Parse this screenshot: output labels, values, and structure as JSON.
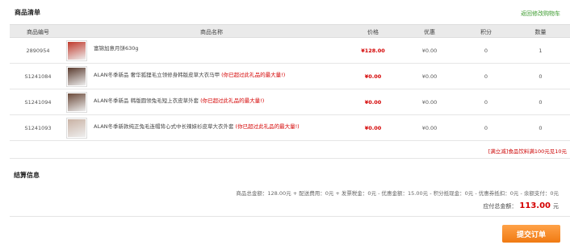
{
  "section_title": "商品清单",
  "back_link": "返回修改购物车",
  "columns": [
    "商品编号",
    "商品名称",
    "价格",
    "优惠",
    "积分",
    "数量"
  ],
  "rows": [
    {
      "id": "2890954",
      "name": "富锦加意月饼630g",
      "warn": "",
      "price": "¥128.00",
      "discount": "¥0.00",
      "points": "0",
      "qty": "1",
      "thumb_color": "#c0392b"
    },
    {
      "id": "S1241084",
      "name": "ALAN冬季新品 奢华狐狸毛立领修身韩版皮草大衣马甲",
      "warn": "(你已超过此礼品的最大量!)",
      "price": "¥0.00",
      "discount": "¥0.00",
      "points": "0",
      "qty": "0",
      "thumb_color": "#5a3b2e"
    },
    {
      "id": "S1241094",
      "name": "ALAN冬季新品 韩版圆领兔毛短上衣皮草外套",
      "warn": "(你已超过此礼品的最大量!)",
      "price": "¥0.00",
      "discount": "¥0.00",
      "points": "0",
      "qty": "0",
      "thumb_color": "#6b4a3a"
    },
    {
      "id": "S1241093",
      "name": "ALAN冬季新款纯正兔毛连帽背心式中长辣妹衫皮草大衣外套",
      "warn": "(你已超过此礼品的最大量!)",
      "price": "¥0.00",
      "discount": "¥0.00",
      "points": "0",
      "qty": "0",
      "thumb_color": "#c9b2a4"
    }
  ],
  "promo": "[满立减]食品饮料满100元见10元",
  "settle_title": "结算信息",
  "summary": "商品总金额：128.00元  + 配送费用：0元  + 发票税金：0元  - 优惠金额：15.00元  - 积分抵现金：0元  - 优惠券抵扣：0元  - 余额支付：0元",
  "total_label": "应付总金额：",
  "total_amount": "113.00",
  "total_unit": "元",
  "submit_label": "提交订单"
}
